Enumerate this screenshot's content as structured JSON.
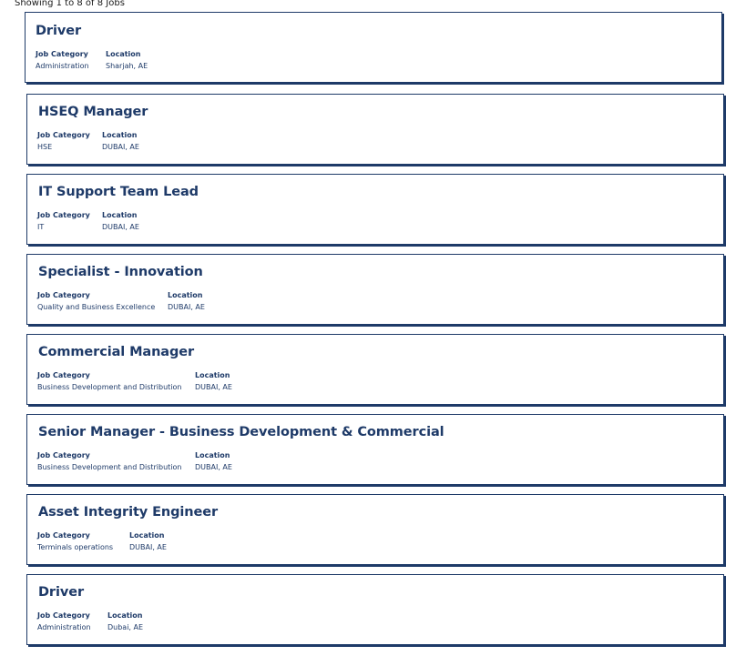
{
  "results": {
    "summary": "Showing 1 to 8 of 8 Jobs"
  },
  "jobs": [
    {
      "title": "Driver",
      "category_label": "Job Category",
      "category": "Administration",
      "location_label": "Location",
      "location": "Sharjah, AE"
    },
    {
      "title": "HSEQ Manager",
      "category_label": "Job Category",
      "category": "HSE",
      "location_label": "Location",
      "location": "DUBAI, AE"
    },
    {
      "title": "IT Support Team Lead",
      "category_label": "Job Category",
      "category": "IT",
      "location_label": "Location",
      "location": "DUBAI, AE"
    },
    {
      "title": "Specialist - Innovation",
      "category_label": "Job Category",
      "category": "Quality and Business Excellence",
      "location_label": "Location",
      "location": "DUBAI, AE"
    },
    {
      "title": "Commercial Manager",
      "category_label": "Job Category",
      "category": "Business Development and Distribution",
      "location_label": "Location",
      "location": "DUBAI, AE"
    },
    {
      "title": "Senior Manager - Business Development & Commercial",
      "category_label": "Job Category",
      "category": "Business Development and Distribution",
      "location_label": "Location",
      "location": "DUBAI, AE"
    },
    {
      "title": "Asset Integrity Engineer",
      "category_label": "Job Category",
      "category": "Terminals operations",
      "location_label": "Location",
      "location": "DUBAI, AE"
    },
    {
      "title": "Driver",
      "category_label": "Job Category",
      "category": "Administration",
      "location_label": "Location",
      "location": "Dubai, AE"
    }
  ]
}
